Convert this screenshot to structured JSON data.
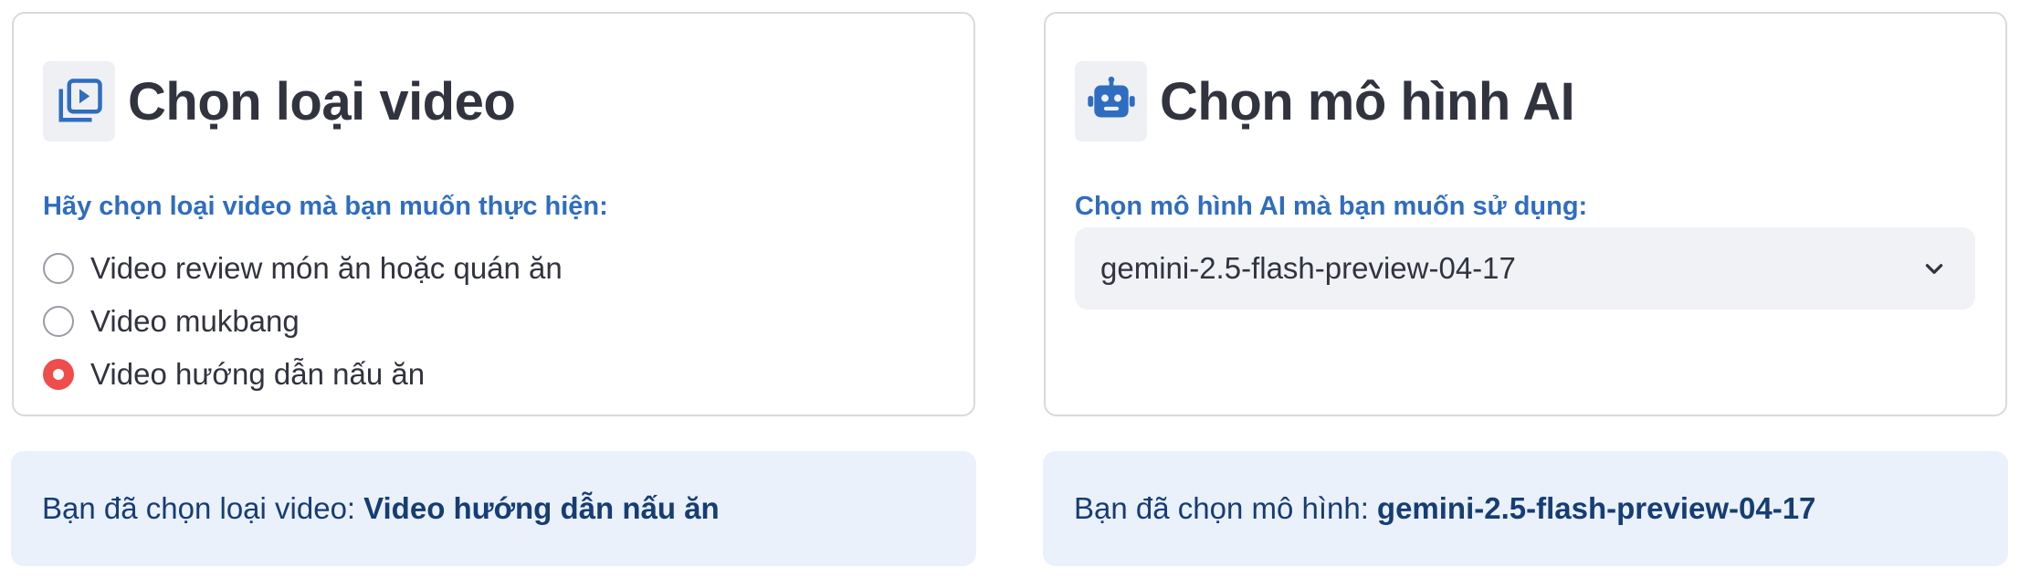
{
  "video_card": {
    "title": "Chọn loại video",
    "icon": "video-library-icon",
    "question": "Hãy chọn loại video mà bạn muốn thực hiện:",
    "options": [
      {
        "label": "Video review món ăn hoặc quán ăn",
        "selected": false
      },
      {
        "label": "Video mukbang",
        "selected": false
      },
      {
        "label": "Video hướng dẫn nấu ăn",
        "selected": true
      }
    ]
  },
  "model_card": {
    "title": "Chọn mô hình AI",
    "icon": "robot-icon",
    "question": "Chọn mô hình AI mà bạn muốn sử dụng:",
    "selected_value": "gemini-2.5-flash-preview-04-17"
  },
  "video_info": {
    "prefix": "Bạn đã chọn loại video:",
    "value": "Video hướng dẫn nấu ăn"
  },
  "model_info": {
    "prefix": "Bạn đã chọn mô hình:",
    "value": "gemini-2.5-flash-preview-04-17"
  },
  "colors": {
    "accent_blue": "#2f6dc0",
    "radio_selected": "#f04c4c",
    "info_background": "#eaf1fb",
    "info_text": "#163d74"
  }
}
